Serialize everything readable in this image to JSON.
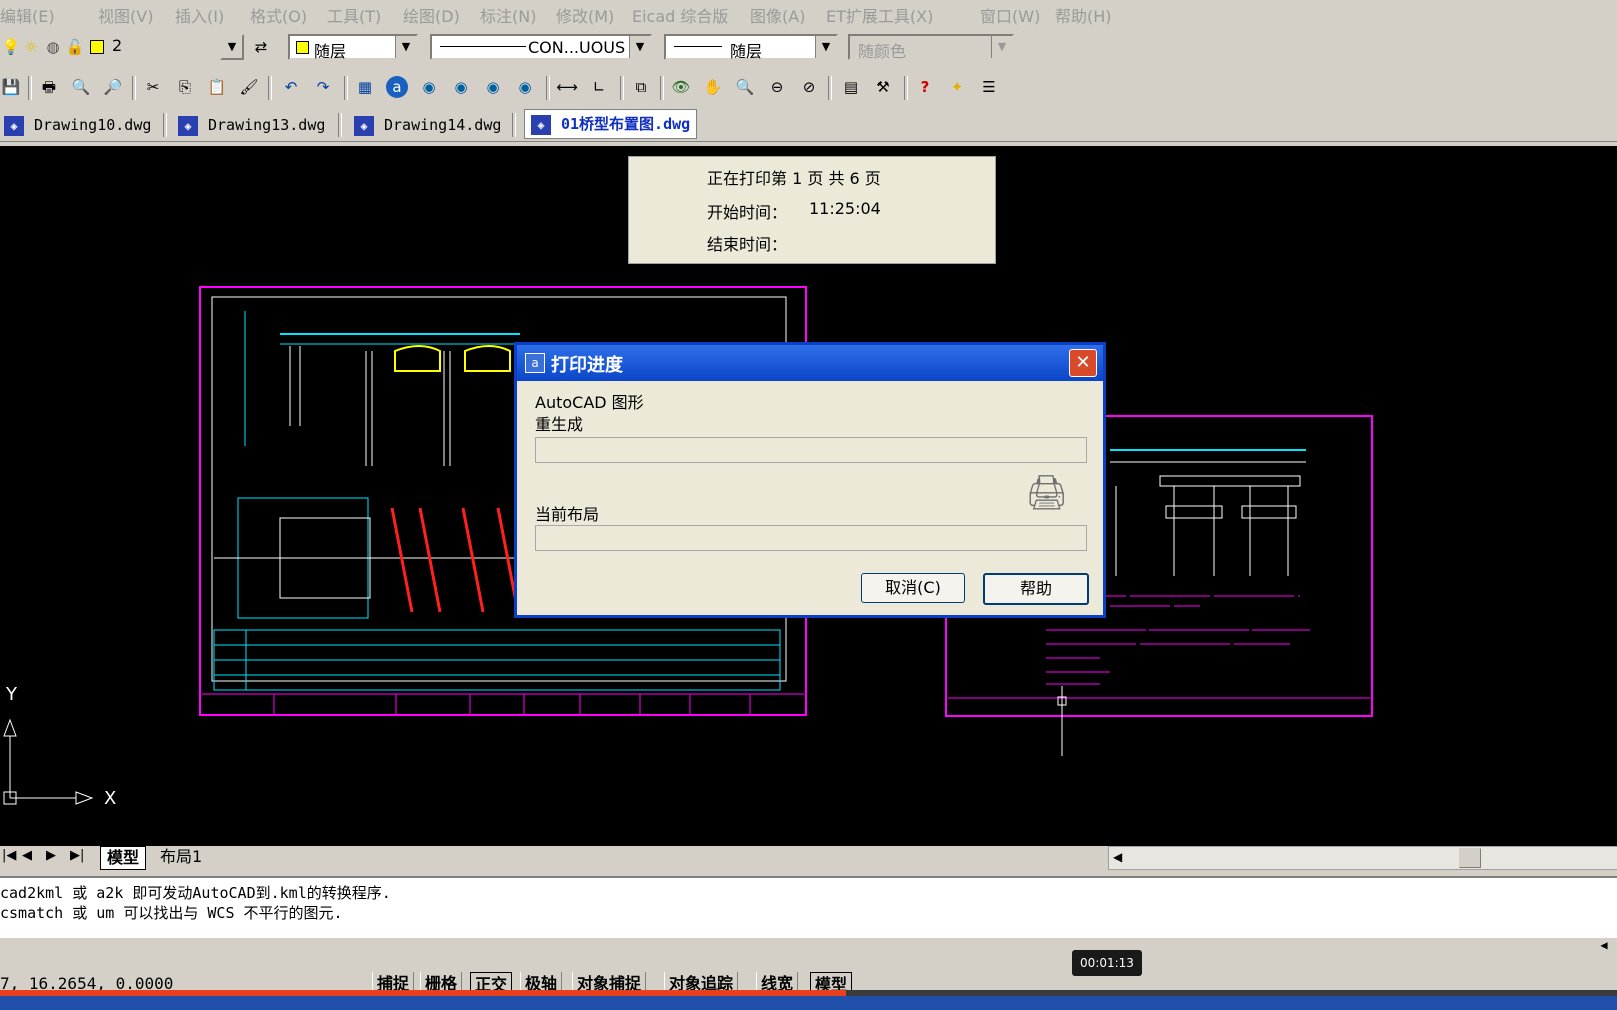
{
  "menu": [
    "编辑(E)",
    "视图(V)",
    "插入(I)",
    "格式(O)",
    "工具(T)",
    "绘图(D)",
    "标注(N)",
    "修改(M)",
    "Eicad 综合版",
    "图像(A)",
    "ET扩展工具(X)",
    "窗口(W)",
    "帮助(H)"
  ],
  "props_toolbar": {
    "layer_value": "2",
    "color_value": "随层",
    "linetype_value": "CON...UOUS",
    "lineweight_value": "随层",
    "plotstyle_value": "随颜色"
  },
  "doc_tabs": [
    {
      "label": "Drawing10.dwg",
      "active": false
    },
    {
      "label": "Drawing13.dwg",
      "active": false
    },
    {
      "label": "Drawing14.dwg",
      "active": false
    },
    {
      "label": "01桥型布置图.dwg",
      "active": true
    }
  ],
  "print_status": {
    "page_line": "正在打印第 1 页   共 6 页",
    "start_label": "开始时间：",
    "start_value": "11:25:04",
    "end_label": "结束时间："
  },
  "dialog": {
    "title": "打印进度",
    "line1": "AutoCAD 图形",
    "line2": "重生成",
    "current_layout_label": "当前布局",
    "cancel_label": "取消(C)",
    "help_label": "帮助"
  },
  "layout_tabs": [
    "模型",
    "布局1"
  ],
  "ucs": {
    "x_label": "X",
    "y_label": "Y"
  },
  "command_lines": [
    "cad2kml 或 a2k 即可发动AutoCAD到.kml的转换程序.",
    "csmatch 或 um 可以找出与 WCS 不平行的图元."
  ],
  "status": {
    "coords": "7, 16.2654, 0.0000",
    "buttons": [
      "捕捉",
      "栅格",
      "正交",
      "极轴",
      "对象捕捉",
      "对象追踪",
      "线宽",
      "模型"
    ]
  },
  "video": {
    "timestamp": "00:01:13",
    "progress": 0.523
  },
  "colors": {
    "canvas": "#000000",
    "magenta": "#ff00ff",
    "cyan": "#00e5ff",
    "dialog_title": "#0a46c8"
  }
}
